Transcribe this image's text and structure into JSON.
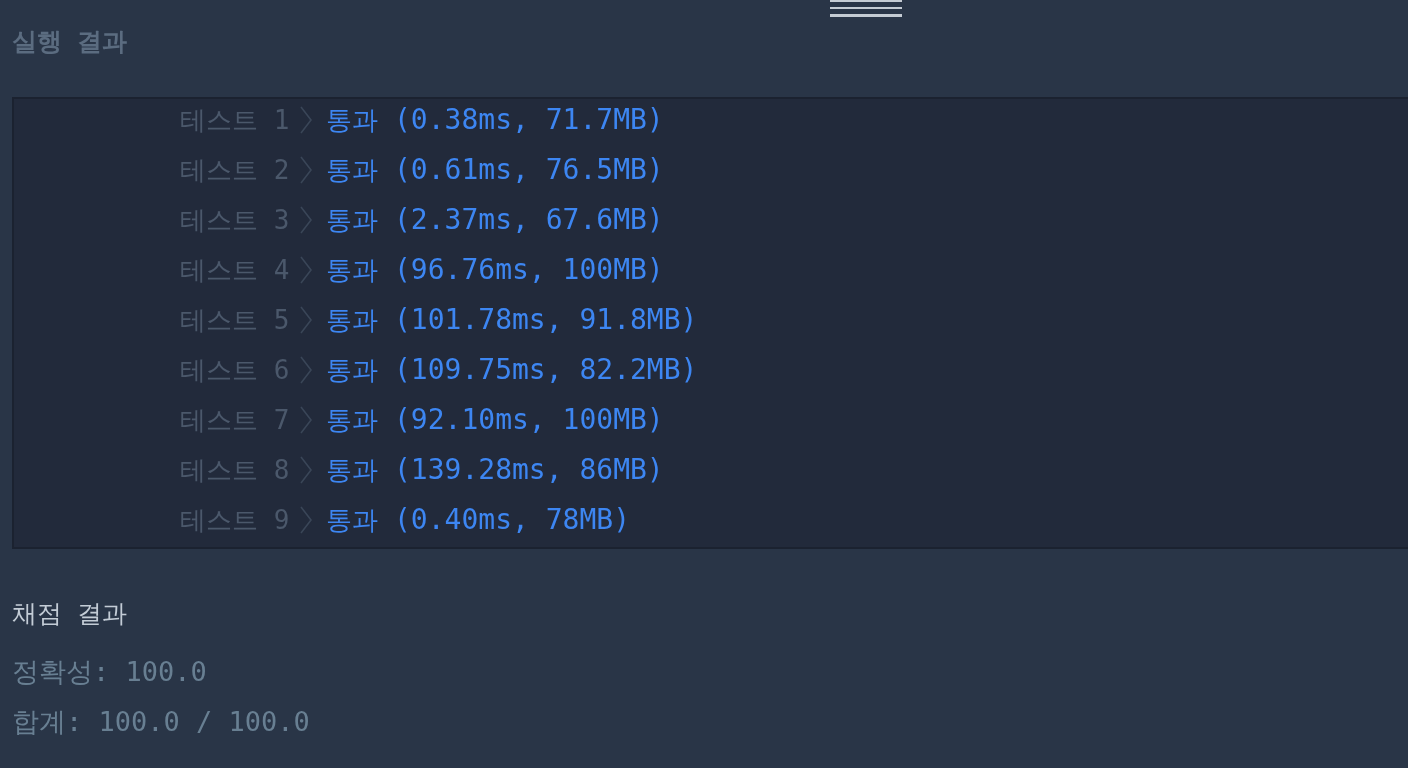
{
  "output_panel": {
    "title": "실행 결과",
    "results": [
      {
        "label": "테스트 1",
        "status": "통과",
        "detail": "(0.38ms, 71.7MB)"
      },
      {
        "label": "테스트 2",
        "status": "통과",
        "detail": "(0.61ms, 76.5MB)"
      },
      {
        "label": "테스트 3",
        "status": "통과",
        "detail": "(2.37ms, 67.6MB)"
      },
      {
        "label": "테스트 4",
        "status": "통과",
        "detail": "(96.76ms, 100MB)"
      },
      {
        "label": "테스트 5",
        "status": "통과",
        "detail": "(101.78ms, 91.8MB)"
      },
      {
        "label": "테스트 6",
        "status": "통과",
        "detail": "(109.75ms, 82.2MB)"
      },
      {
        "label": "테스트 7",
        "status": "통과",
        "detail": "(92.10ms, 100MB)"
      },
      {
        "label": "테스트 8",
        "status": "통과",
        "detail": "(139.28ms, 86MB)"
      },
      {
        "label": "테스트 9",
        "status": "통과",
        "detail": "(0.40ms, 78MB)"
      }
    ]
  },
  "grading": {
    "title": "채점 결과",
    "lines": [
      "정확성: 100.0",
      "합계: 100.0 / 100.0"
    ]
  }
}
